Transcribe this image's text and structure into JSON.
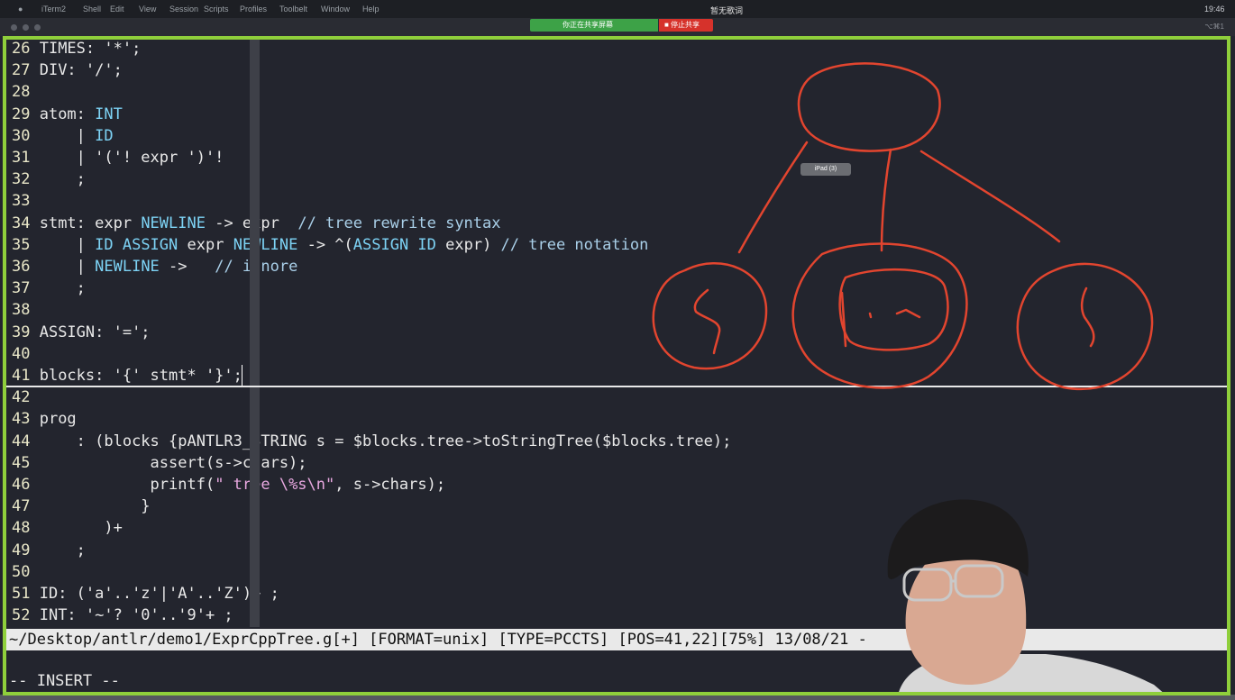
{
  "menubar": {
    "apple": "",
    "app": "iTerm2",
    "items": [
      "Shell",
      "Edit",
      "View",
      "Session",
      "Scripts",
      "Profiles",
      "Toolbelt",
      "Window",
      "Help"
    ],
    "center_title": "暂无歌词",
    "clock": "19:46"
  },
  "sharing": {
    "status": "你正在共享屏幕",
    "stop": "■ 停止共享"
  },
  "titlebar": {
    "shortcut": "⌥⌘1"
  },
  "ipad_label": "iPad (3)",
  "editor": {
    "lines": [
      {
        "n": "26",
        "segs": [
          {
            "t": " TIMES: '*';",
            "c": ""
          }
        ]
      },
      {
        "n": "27",
        "segs": [
          {
            "t": " DIV: '/';",
            "c": ""
          }
        ]
      },
      {
        "n": "28",
        "segs": []
      },
      {
        "n": "29",
        "segs": [
          {
            "t": " atom: ",
            "c": ""
          },
          {
            "t": "INT",
            "c": "kw"
          }
        ]
      },
      {
        "n": "30",
        "segs": [
          {
            "t": "     | ",
            "c": ""
          },
          {
            "t": "ID",
            "c": "kw"
          }
        ]
      },
      {
        "n": "31",
        "segs": [
          {
            "t": "     | '('! expr ')'!",
            "c": ""
          }
        ]
      },
      {
        "n": "32",
        "segs": [
          {
            "t": "     ;",
            "c": ""
          }
        ]
      },
      {
        "n": "33",
        "segs": []
      },
      {
        "n": "34",
        "segs": [
          {
            "t": " stmt: expr ",
            "c": ""
          },
          {
            "t": "NEWLINE",
            "c": "kw"
          },
          {
            "t": " -> expr  ",
            "c": ""
          },
          {
            "t": "// tree rewrite syntax",
            "c": "cmt"
          }
        ]
      },
      {
        "n": "35",
        "segs": [
          {
            "t": "     | ",
            "c": ""
          },
          {
            "t": "ID ASSIGN",
            "c": "kw"
          },
          {
            "t": " expr ",
            "c": ""
          },
          {
            "t": "NEWLINE",
            "c": "kw"
          },
          {
            "t": " -> ^(",
            "c": ""
          },
          {
            "t": "ASSIGN ID",
            "c": "kw"
          },
          {
            "t": " expr) ",
            "c": ""
          },
          {
            "t": "// tree notation",
            "c": "cmt"
          }
        ]
      },
      {
        "n": "36",
        "segs": [
          {
            "t": "     | ",
            "c": ""
          },
          {
            "t": "NEWLINE",
            "c": "kw"
          },
          {
            "t": " ->   ",
            "c": ""
          },
          {
            "t": "// ignore",
            "c": "cmt"
          }
        ]
      },
      {
        "n": "37",
        "segs": [
          {
            "t": "     ;",
            "c": ""
          }
        ]
      },
      {
        "n": "38",
        "segs": []
      },
      {
        "n": "39",
        "segs": [
          {
            "t": " ASSIGN: '=';",
            "c": ""
          }
        ]
      },
      {
        "n": "40",
        "segs": []
      },
      {
        "n": "41",
        "segs": [
          {
            "t": " blocks: '{' stmt* '}';",
            "c": ""
          }
        ]
      },
      {
        "n": "42",
        "segs": []
      },
      {
        "n": "43",
        "segs": [
          {
            "t": " prog",
            "c": ""
          }
        ]
      },
      {
        "n": "44",
        "segs": [
          {
            "t": "     : (blocks {pANTLR3_STRING s = $blocks.tree->toStringTree($blocks.tree);",
            "c": ""
          }
        ]
      },
      {
        "n": "45",
        "segs": [
          {
            "t": "             assert(s->chars);",
            "c": ""
          }
        ]
      },
      {
        "n": "46",
        "segs": [
          {
            "t": "             printf(",
            "c": ""
          },
          {
            "t": "\" tree \\%s\\n\"",
            "c": "str"
          },
          {
            "t": ", s->chars);",
            "c": ""
          }
        ]
      },
      {
        "n": "47",
        "segs": [
          {
            "t": "            }",
            "c": ""
          }
        ]
      },
      {
        "n": "48",
        "segs": [
          {
            "t": "        )+",
            "c": ""
          }
        ]
      },
      {
        "n": "49",
        "segs": [
          {
            "t": "     ;",
            "c": ""
          }
        ]
      },
      {
        "n": "50",
        "segs": []
      },
      {
        "n": "51",
        "segs": [
          {
            "t": " ID: ('a'..'z'|'A'..'Z')+ ;",
            "c": ""
          }
        ]
      },
      {
        "n": "52",
        "segs": [
          {
            "t": " INT: '~'? '0'..'9'+ ;",
            "c": ""
          }
        ]
      }
    ],
    "status_line": "~/Desktop/antlr/demo1/ExprCppTree.g[+] [FORMAT=unix] [TYPE=PCCTS] [POS=41,22][75%] 13/08/21 -",
    "mode": "-- INSERT --"
  },
  "colors": {
    "frame": "#8fcf3b",
    "drawing": "#e2452f",
    "background": "#23252e"
  }
}
